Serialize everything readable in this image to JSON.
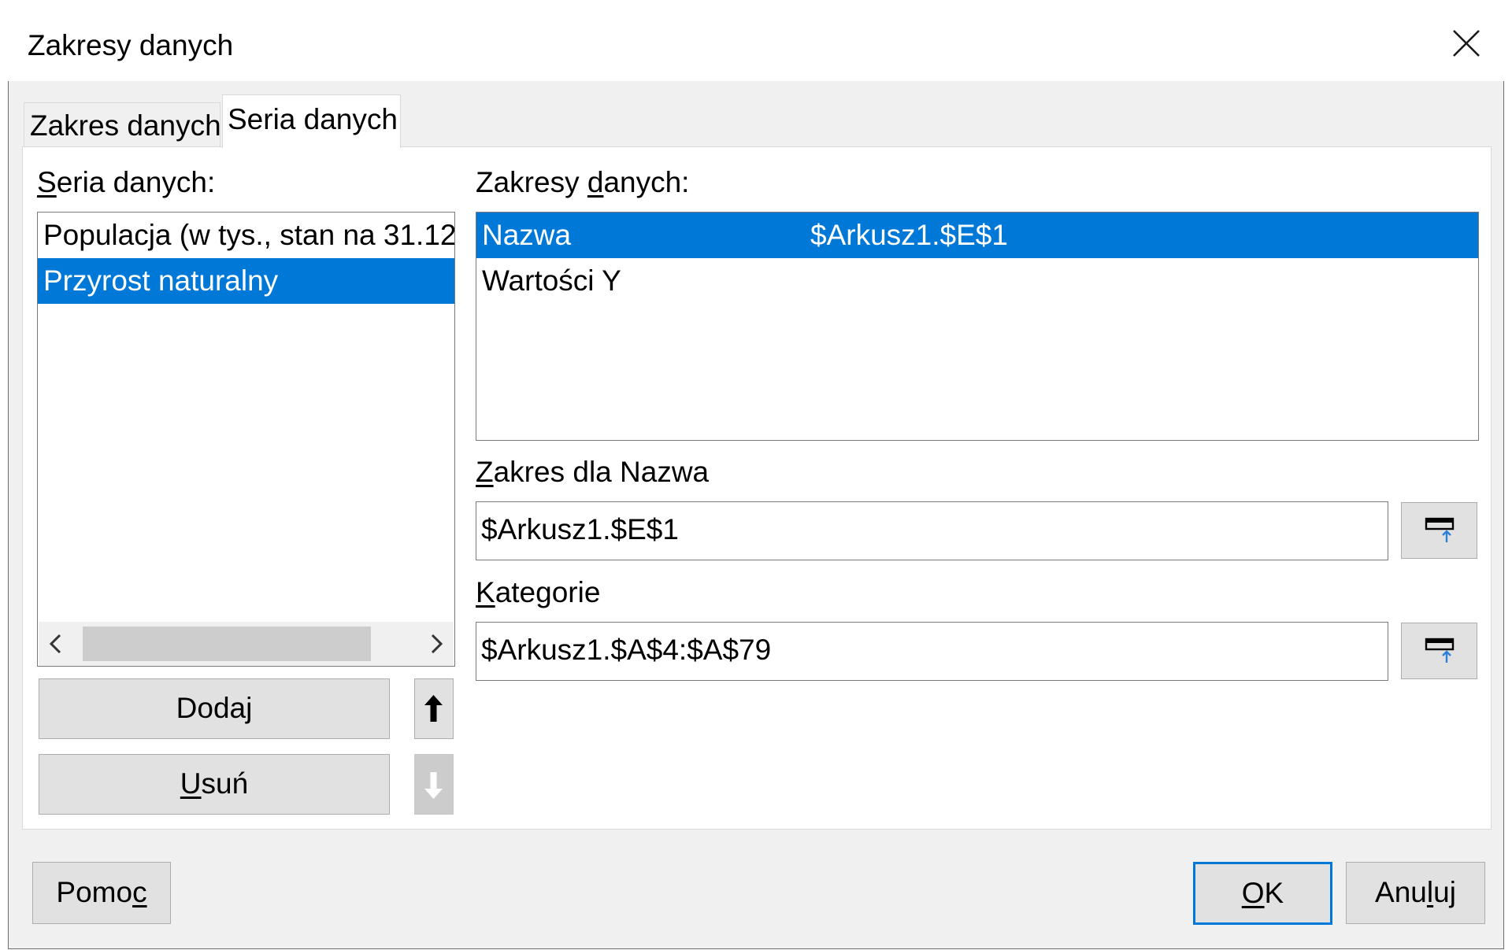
{
  "dialog": {
    "title": "Zakresy danych"
  },
  "tabs": [
    {
      "label": "Zakres danych",
      "active": false
    },
    {
      "label": "Seria danych",
      "active": true
    }
  ],
  "series_panel": {
    "label_first": "S",
    "label_rest": "eria danych:",
    "items": [
      {
        "label": "Populacja (w tys., stan na 31.12",
        "selected": false
      },
      {
        "label": "Przyrost naturalny",
        "selected": true
      }
    ],
    "add_button": {
      "before": "Doda",
      "mnemonic": "j",
      "after": ""
    },
    "remove_button": {
      "before": "",
      "mnemonic": "U",
      "after": "suń"
    },
    "move_up_icon": "arrow-up-icon",
    "move_down_icon": "arrow-down-icon"
  },
  "ranges_panel": {
    "label_before": "Zakresy ",
    "label_mnemonic": "d",
    "label_after": "anych:",
    "items": [
      {
        "role": "Nazwa",
        "range": "$Arkusz1.$E$1",
        "selected": true
      },
      {
        "role": "Wartości Y",
        "range": "",
        "selected": false
      }
    ],
    "range_for_label_mnemonic": "Z",
    "range_for_label_rest": "akres dla Nazwa",
    "range_for_value": "$Arkusz1.$E$1",
    "categories_label_mnemonic": "K",
    "categories_label_rest": "ategorie",
    "categories_value": "$Arkusz1.$A$4:$A$79",
    "shrink_icon": "shrink-range-icon"
  },
  "footer": {
    "help_button": {
      "before": "Pomo",
      "mnemonic": "c",
      "after": ""
    },
    "ok_button": {
      "before": "",
      "mnemonic": "O",
      "after": "K"
    },
    "cancel_button": {
      "before": "Anu",
      "mnemonic": "l",
      "after": "uj"
    }
  },
  "colors": {
    "selection": "#0078d7",
    "dialog_background": "#f0f0f0",
    "button_face": "#e1e1e1",
    "scroll_thumb": "#cdcdcd"
  }
}
